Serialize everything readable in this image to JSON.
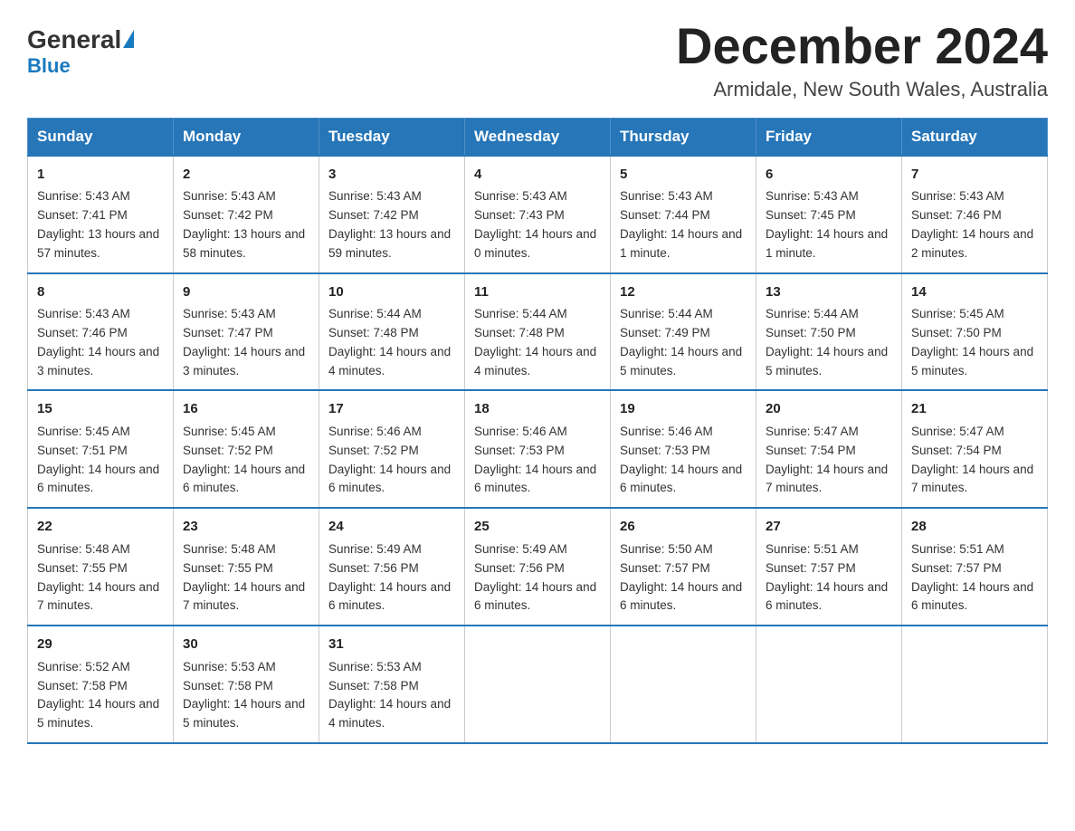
{
  "header": {
    "logo_general": "General",
    "logo_blue": "Blue",
    "month_title": "December 2024",
    "location": "Armidale, New South Wales, Australia"
  },
  "days_of_week": [
    "Sunday",
    "Monday",
    "Tuesday",
    "Wednesday",
    "Thursday",
    "Friday",
    "Saturday"
  ],
  "weeks": [
    [
      {
        "num": "1",
        "sunrise": "5:43 AM",
        "sunset": "7:41 PM",
        "daylight": "13 hours and 57 minutes."
      },
      {
        "num": "2",
        "sunrise": "5:43 AM",
        "sunset": "7:42 PM",
        "daylight": "13 hours and 58 minutes."
      },
      {
        "num": "3",
        "sunrise": "5:43 AM",
        "sunset": "7:42 PM",
        "daylight": "13 hours and 59 minutes."
      },
      {
        "num": "4",
        "sunrise": "5:43 AM",
        "sunset": "7:43 PM",
        "daylight": "14 hours and 0 minutes."
      },
      {
        "num": "5",
        "sunrise": "5:43 AM",
        "sunset": "7:44 PM",
        "daylight": "14 hours and 1 minute."
      },
      {
        "num": "6",
        "sunrise": "5:43 AM",
        "sunset": "7:45 PM",
        "daylight": "14 hours and 1 minute."
      },
      {
        "num": "7",
        "sunrise": "5:43 AM",
        "sunset": "7:46 PM",
        "daylight": "14 hours and 2 minutes."
      }
    ],
    [
      {
        "num": "8",
        "sunrise": "5:43 AM",
        "sunset": "7:46 PM",
        "daylight": "14 hours and 3 minutes."
      },
      {
        "num": "9",
        "sunrise": "5:43 AM",
        "sunset": "7:47 PM",
        "daylight": "14 hours and 3 minutes."
      },
      {
        "num": "10",
        "sunrise": "5:44 AM",
        "sunset": "7:48 PM",
        "daylight": "14 hours and 4 minutes."
      },
      {
        "num": "11",
        "sunrise": "5:44 AM",
        "sunset": "7:48 PM",
        "daylight": "14 hours and 4 minutes."
      },
      {
        "num": "12",
        "sunrise": "5:44 AM",
        "sunset": "7:49 PM",
        "daylight": "14 hours and 5 minutes."
      },
      {
        "num": "13",
        "sunrise": "5:44 AM",
        "sunset": "7:50 PM",
        "daylight": "14 hours and 5 minutes."
      },
      {
        "num": "14",
        "sunrise": "5:45 AM",
        "sunset": "7:50 PM",
        "daylight": "14 hours and 5 minutes."
      }
    ],
    [
      {
        "num": "15",
        "sunrise": "5:45 AM",
        "sunset": "7:51 PM",
        "daylight": "14 hours and 6 minutes."
      },
      {
        "num": "16",
        "sunrise": "5:45 AM",
        "sunset": "7:52 PM",
        "daylight": "14 hours and 6 minutes."
      },
      {
        "num": "17",
        "sunrise": "5:46 AM",
        "sunset": "7:52 PM",
        "daylight": "14 hours and 6 minutes."
      },
      {
        "num": "18",
        "sunrise": "5:46 AM",
        "sunset": "7:53 PM",
        "daylight": "14 hours and 6 minutes."
      },
      {
        "num": "19",
        "sunrise": "5:46 AM",
        "sunset": "7:53 PM",
        "daylight": "14 hours and 6 minutes."
      },
      {
        "num": "20",
        "sunrise": "5:47 AM",
        "sunset": "7:54 PM",
        "daylight": "14 hours and 7 minutes."
      },
      {
        "num": "21",
        "sunrise": "5:47 AM",
        "sunset": "7:54 PM",
        "daylight": "14 hours and 7 minutes."
      }
    ],
    [
      {
        "num": "22",
        "sunrise": "5:48 AM",
        "sunset": "7:55 PM",
        "daylight": "14 hours and 7 minutes."
      },
      {
        "num": "23",
        "sunrise": "5:48 AM",
        "sunset": "7:55 PM",
        "daylight": "14 hours and 7 minutes."
      },
      {
        "num": "24",
        "sunrise": "5:49 AM",
        "sunset": "7:56 PM",
        "daylight": "14 hours and 6 minutes."
      },
      {
        "num": "25",
        "sunrise": "5:49 AM",
        "sunset": "7:56 PM",
        "daylight": "14 hours and 6 minutes."
      },
      {
        "num": "26",
        "sunrise": "5:50 AM",
        "sunset": "7:57 PM",
        "daylight": "14 hours and 6 minutes."
      },
      {
        "num": "27",
        "sunrise": "5:51 AM",
        "sunset": "7:57 PM",
        "daylight": "14 hours and 6 minutes."
      },
      {
        "num": "28",
        "sunrise": "5:51 AM",
        "sunset": "7:57 PM",
        "daylight": "14 hours and 6 minutes."
      }
    ],
    [
      {
        "num": "29",
        "sunrise": "5:52 AM",
        "sunset": "7:58 PM",
        "daylight": "14 hours and 5 minutes."
      },
      {
        "num": "30",
        "sunrise": "5:53 AM",
        "sunset": "7:58 PM",
        "daylight": "14 hours and 5 minutes."
      },
      {
        "num": "31",
        "sunrise": "5:53 AM",
        "sunset": "7:58 PM",
        "daylight": "14 hours and 4 minutes."
      },
      null,
      null,
      null,
      null
    ]
  ],
  "labels": {
    "sunrise": "Sunrise:",
    "sunset": "Sunset:",
    "daylight": "Daylight:"
  }
}
